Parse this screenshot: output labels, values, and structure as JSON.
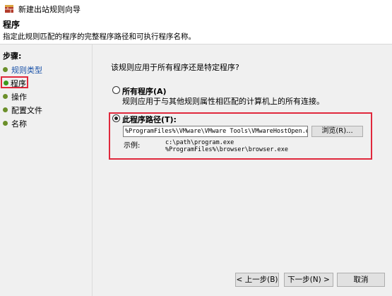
{
  "window": {
    "title": "新建出站规则向导"
  },
  "header": {
    "title": "程序",
    "description": "指定此规则匹配的程序的完整程序路径和可执行程序名称。"
  },
  "steps": {
    "title": "步骤:",
    "items": [
      {
        "label": "规则类型",
        "state": "link"
      },
      {
        "label": "程序",
        "state": "current"
      },
      {
        "label": "操作",
        "state": "pending"
      },
      {
        "label": "配置文件",
        "state": "pending"
      },
      {
        "label": "名称",
        "state": "pending"
      }
    ]
  },
  "main": {
    "question": "该规则应用于所有程序还是特定程序?",
    "option_all": {
      "label": "所有程序(A)",
      "description": "规则应用于与其他规则属性相匹配的计算机上的所有连接。",
      "selected": false
    },
    "option_path": {
      "label": "此程序路径(T):",
      "selected": true,
      "value": "%ProgramFiles%\\VMware\\VMware Tools\\VMwareHostOpen.exe",
      "browse_label": "浏览(R)...",
      "example_label": "示例:",
      "example_lines": [
        "c:\\path\\program.exe",
        "%ProgramFiles%\\browser\\browser.exe"
      ]
    }
  },
  "buttons": {
    "back": "< 上一步(B)",
    "next": "下一步(N) >",
    "cancel": "取消"
  },
  "colors": {
    "highlight": "#e0283c",
    "link": "#1a52a8",
    "step_dot": "#6b8f2a",
    "panel_bg": "#f0f0f0"
  }
}
